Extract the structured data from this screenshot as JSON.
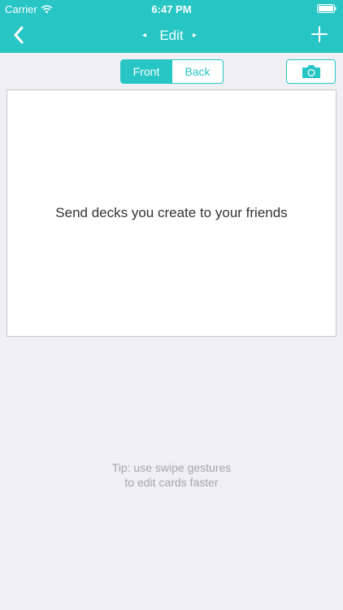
{
  "status_bar": {
    "carrier": "Carrier",
    "time": "6:47 PM",
    "icons": {
      "wifi": "wifi-icon",
      "battery": "battery-icon"
    }
  },
  "nav": {
    "title": "Edit",
    "prev_arrow": "◂",
    "next_arrow": "▸",
    "back_icon": "chevron-left-icon",
    "add_icon": "plus-icon"
  },
  "card_side": {
    "options": [
      "Front",
      "Back"
    ],
    "selected": "Front"
  },
  "camera": {
    "icon": "camera-icon"
  },
  "card": {
    "text": "Send decks you create to your friends"
  },
  "tip": {
    "line1": "Tip: use swipe gestures",
    "line2": "to edit cards faster"
  },
  "colors": {
    "accent": "#28c5c5",
    "background": "#efeff4",
    "card": "#ffffff",
    "tip_text": "#a5a5aa"
  }
}
